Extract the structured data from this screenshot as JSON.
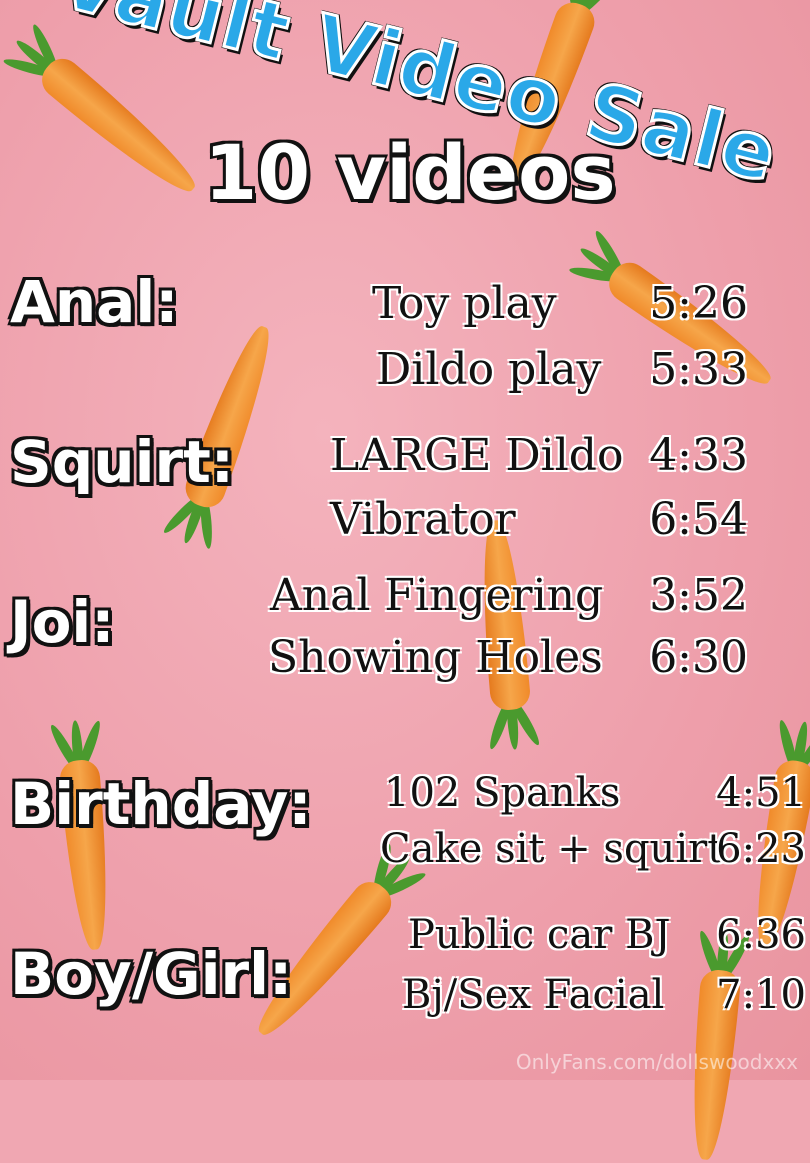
{
  "title": "Vault Video Sale",
  "subtitle": "10 videos",
  "categories": [
    {
      "label": "Anal:",
      "items": [
        {
          "name": "Toy play",
          "duration": "5:26"
        },
        {
          "name": "Dildo play",
          "duration": "5:33"
        }
      ]
    },
    {
      "label": "Squirt:",
      "items": [
        {
          "name": "LARGE Dildo",
          "duration": "4:33"
        },
        {
          "name": "Vibrator",
          "duration": "6:54"
        }
      ]
    },
    {
      "label": "Joi:",
      "items": [
        {
          "name": "Anal Fingering",
          "duration": "3:52"
        },
        {
          "name": "Showing Holes",
          "duration": "6:30"
        }
      ]
    },
    {
      "label": "Birthday:",
      "items": [
        {
          "name": "102 Spanks",
          "duration": "4:51"
        },
        {
          "name": "Cake sit + squirt",
          "duration": "6:23"
        }
      ]
    },
    {
      "label": "Boy/Girl:",
      "items": [
        {
          "name": "Public car BJ",
          "duration": "6:36"
        },
        {
          "name": "Bj/Sex Facial",
          "duration": "7:10"
        }
      ]
    }
  ],
  "watermark": "OnlyFans.com/dollswoodxxx",
  "colors": {
    "background": "#f0a7b2",
    "title": "#2aa8e8",
    "carrot": "#f08a2a",
    "leaf": "#4a9a2e"
  }
}
